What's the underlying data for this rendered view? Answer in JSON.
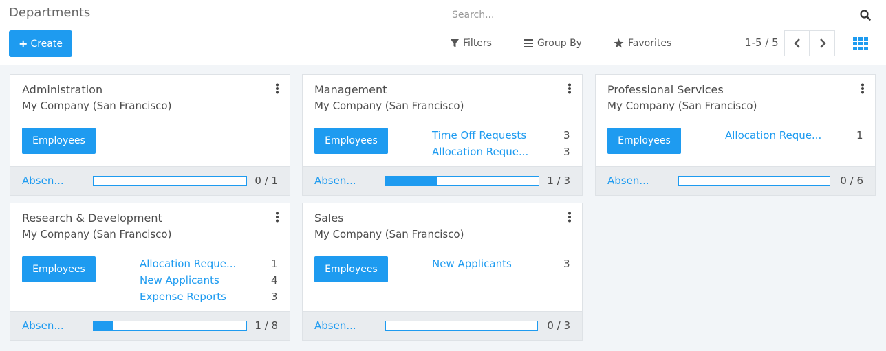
{
  "header": {
    "title": "Departments",
    "create_label": "Create",
    "search_placeholder": "Search...",
    "filters_label": "Filters",
    "groupby_label": "Group By",
    "favorites_label": "Favorites",
    "pager": "1-5 / 5"
  },
  "colors": {
    "accent": "#1e9bf0",
    "footer_bg": "#e9ecef",
    "page_bg": "#f2f5f8"
  },
  "cards": [
    {
      "title": "Administration",
      "company": "My Company (San Francisco)",
      "button": "Employees",
      "stats": [],
      "footer_link": "Absen...",
      "progress": {
        "value": 0,
        "max": 1,
        "label": "0 / 1"
      }
    },
    {
      "title": "Management",
      "company": "My Company (San Francisco)",
      "button": "Employees",
      "stats": [
        {
          "label": "Time Off Requests",
          "count": "3"
        },
        {
          "label": "Allocation Reque...",
          "count": "3"
        }
      ],
      "footer_link": "Absen...",
      "progress": {
        "value": 1,
        "max": 3,
        "label": "1 / 3"
      }
    },
    {
      "title": "Professional Services",
      "company": "My Company (San Francisco)",
      "button": "Employees",
      "stats": [
        {
          "label": "Allocation Reque...",
          "count": "1"
        }
      ],
      "footer_link": "Absen...",
      "progress": {
        "value": 0,
        "max": 6,
        "label": "0 / 6"
      }
    },
    {
      "title": "Research & Development",
      "company": "My Company (San Francisco)",
      "button": "Employees",
      "stats": [
        {
          "label": "Allocation Reque...",
          "count": "1"
        },
        {
          "label": "New Applicants",
          "count": "4"
        },
        {
          "label": "Expense Reports",
          "count": "3"
        }
      ],
      "footer_link": "Absen...",
      "progress": {
        "value": 1,
        "max": 8,
        "label": "1 / 8"
      }
    },
    {
      "title": "Sales",
      "company": "My Company (San Francisco)",
      "button": "Employees",
      "stats": [
        {
          "label": "New Applicants",
          "count": "3"
        }
      ],
      "footer_link": "Absen...",
      "progress": {
        "value": 0,
        "max": 3,
        "label": "0 / 3"
      }
    }
  ]
}
